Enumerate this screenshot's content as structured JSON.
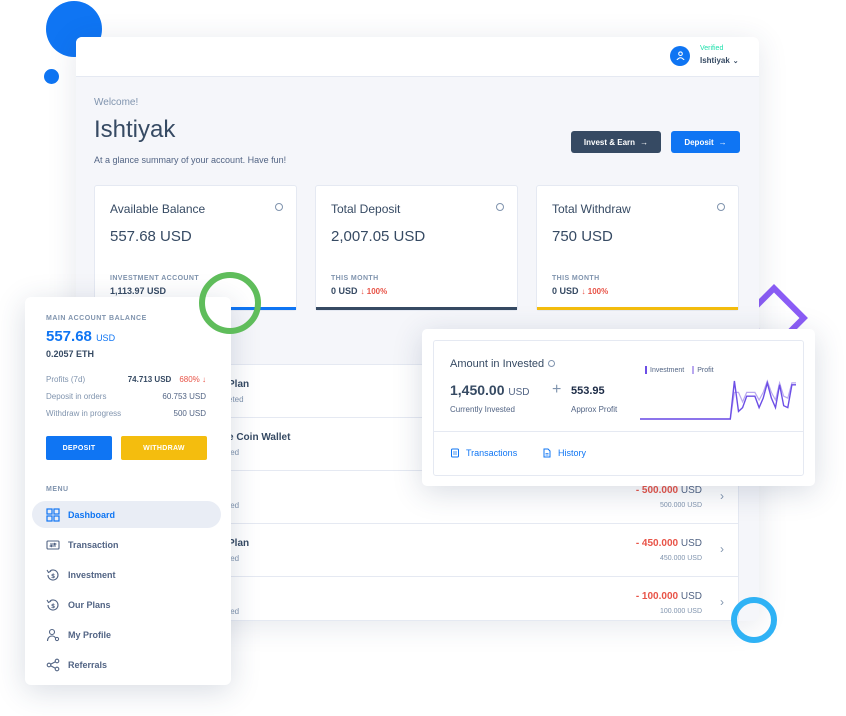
{
  "colors": {
    "primary": "#0f75f3",
    "dark": "#364a63",
    "warning": "#f4bd0e",
    "danger": "#e85347",
    "success": "#1ee0ac",
    "purple": "#8b5df6"
  },
  "header": {
    "status": "Verified",
    "user_name": "Ishtiyak"
  },
  "welcome": {
    "greeting": "Welcome!",
    "name": "Ishtiyak",
    "subtitle": "At a glance summary of your account. Have fun!"
  },
  "actions": {
    "invest_earn": "Invest & Earn",
    "deposit": "Deposit"
  },
  "cards": [
    {
      "title": "Available Balance",
      "value": "557.68 USD",
      "sub_label": "INVESTMENT ACCOUNT",
      "sub_amount": "1,113.97 USD",
      "change": ""
    },
    {
      "title": "Total Deposit",
      "value": "2,007.05 USD",
      "sub_label": "THIS MONTH",
      "sub_amount": "0 USD",
      "change": "↓ 100%"
    },
    {
      "title": "Total Withdraw",
      "value": "750 USD",
      "sub_label": "THIS MONTH",
      "sub_amount": "0 USD",
      "change": "↓ 100%"
    }
  ],
  "transactions": [
    {
      "title": "Plan",
      "meta": "eted",
      "amount": "",
      "currency": "",
      "sub": ""
    },
    {
      "title": "e Coin Wallet",
      "meta": "ted",
      "amount": "",
      "currency": "",
      "sub": ""
    },
    {
      "title": "",
      "meta": "ted",
      "amount": "- 500.000",
      "currency": "USD",
      "sub": "500.000 USD"
    },
    {
      "title": "Plan",
      "meta": "ted",
      "amount": "- 450.000",
      "currency": "USD",
      "sub": "450.000 USD"
    },
    {
      "title": "",
      "meta": "ted",
      "amount": "- 100.000",
      "currency": "USD",
      "sub": "100.000 USD"
    }
  ],
  "sidebar": {
    "balance_label": "MAIN ACCOUNT BALANCE",
    "balance": "557.68",
    "balance_currency": "USD",
    "eth": "0.2057 ETH",
    "stats": [
      {
        "label": "Profits (7d)",
        "value": "74.713 USD",
        "change": "680% ↓"
      },
      {
        "label": "Deposit in orders",
        "value": "60.753 USD",
        "change": ""
      },
      {
        "label": "Withdraw in progress",
        "value": "500 USD",
        "change": ""
      }
    ],
    "deposit_label": "DEPOSIT",
    "withdraw_label": "WITHDRAW",
    "menu_label": "MENU",
    "menu": [
      {
        "label": "Dashboard",
        "icon": "dashboard-icon"
      },
      {
        "label": "Transaction",
        "icon": "transaction-icon"
      },
      {
        "label": "Investment",
        "icon": "investment-icon"
      },
      {
        "label": "Our Plans",
        "icon": "plans-icon"
      },
      {
        "label": "My Profile",
        "icon": "profile-icon"
      },
      {
        "label": "Referrals",
        "icon": "share-icon"
      }
    ]
  },
  "invested": {
    "title": "Amount in Invested",
    "value": "1,450.00",
    "currency": "USD",
    "value_label": "Currently Invested",
    "profit": "553.95",
    "profit_label": "Approx Profit",
    "legend": [
      "Investment",
      "Profit"
    ],
    "links": [
      "Transactions",
      "History"
    ]
  },
  "chart_data": {
    "type": "line",
    "series": [
      {
        "name": "Investment",
        "values": [
          0,
          0,
          0,
          0,
          0,
          0,
          0,
          0,
          0,
          0,
          0,
          0,
          0,
          0,
          0,
          0,
          0,
          0,
          0,
          0,
          0,
          0,
          0,
          1,
          0.2,
          0.3,
          0.6,
          0.6,
          0.6,
          0.3,
          0.55,
          0.95,
          0.55,
          0.3,
          0.9,
          0.35,
          0.3,
          0.9,
          0.9
        ]
      },
      {
        "name": "Profit",
        "values": [
          0,
          0,
          0,
          0,
          0,
          0,
          0,
          0,
          0,
          0,
          0,
          0,
          0,
          0,
          0,
          0,
          0,
          0,
          0,
          0,
          0,
          0,
          0,
          0.7,
          0.7,
          0.45,
          0.7,
          0.7,
          0.7,
          0.5,
          0.7,
          1,
          0.7,
          0.5,
          0.95,
          0.6,
          0.55,
          0.95,
          0.95
        ]
      }
    ]
  }
}
